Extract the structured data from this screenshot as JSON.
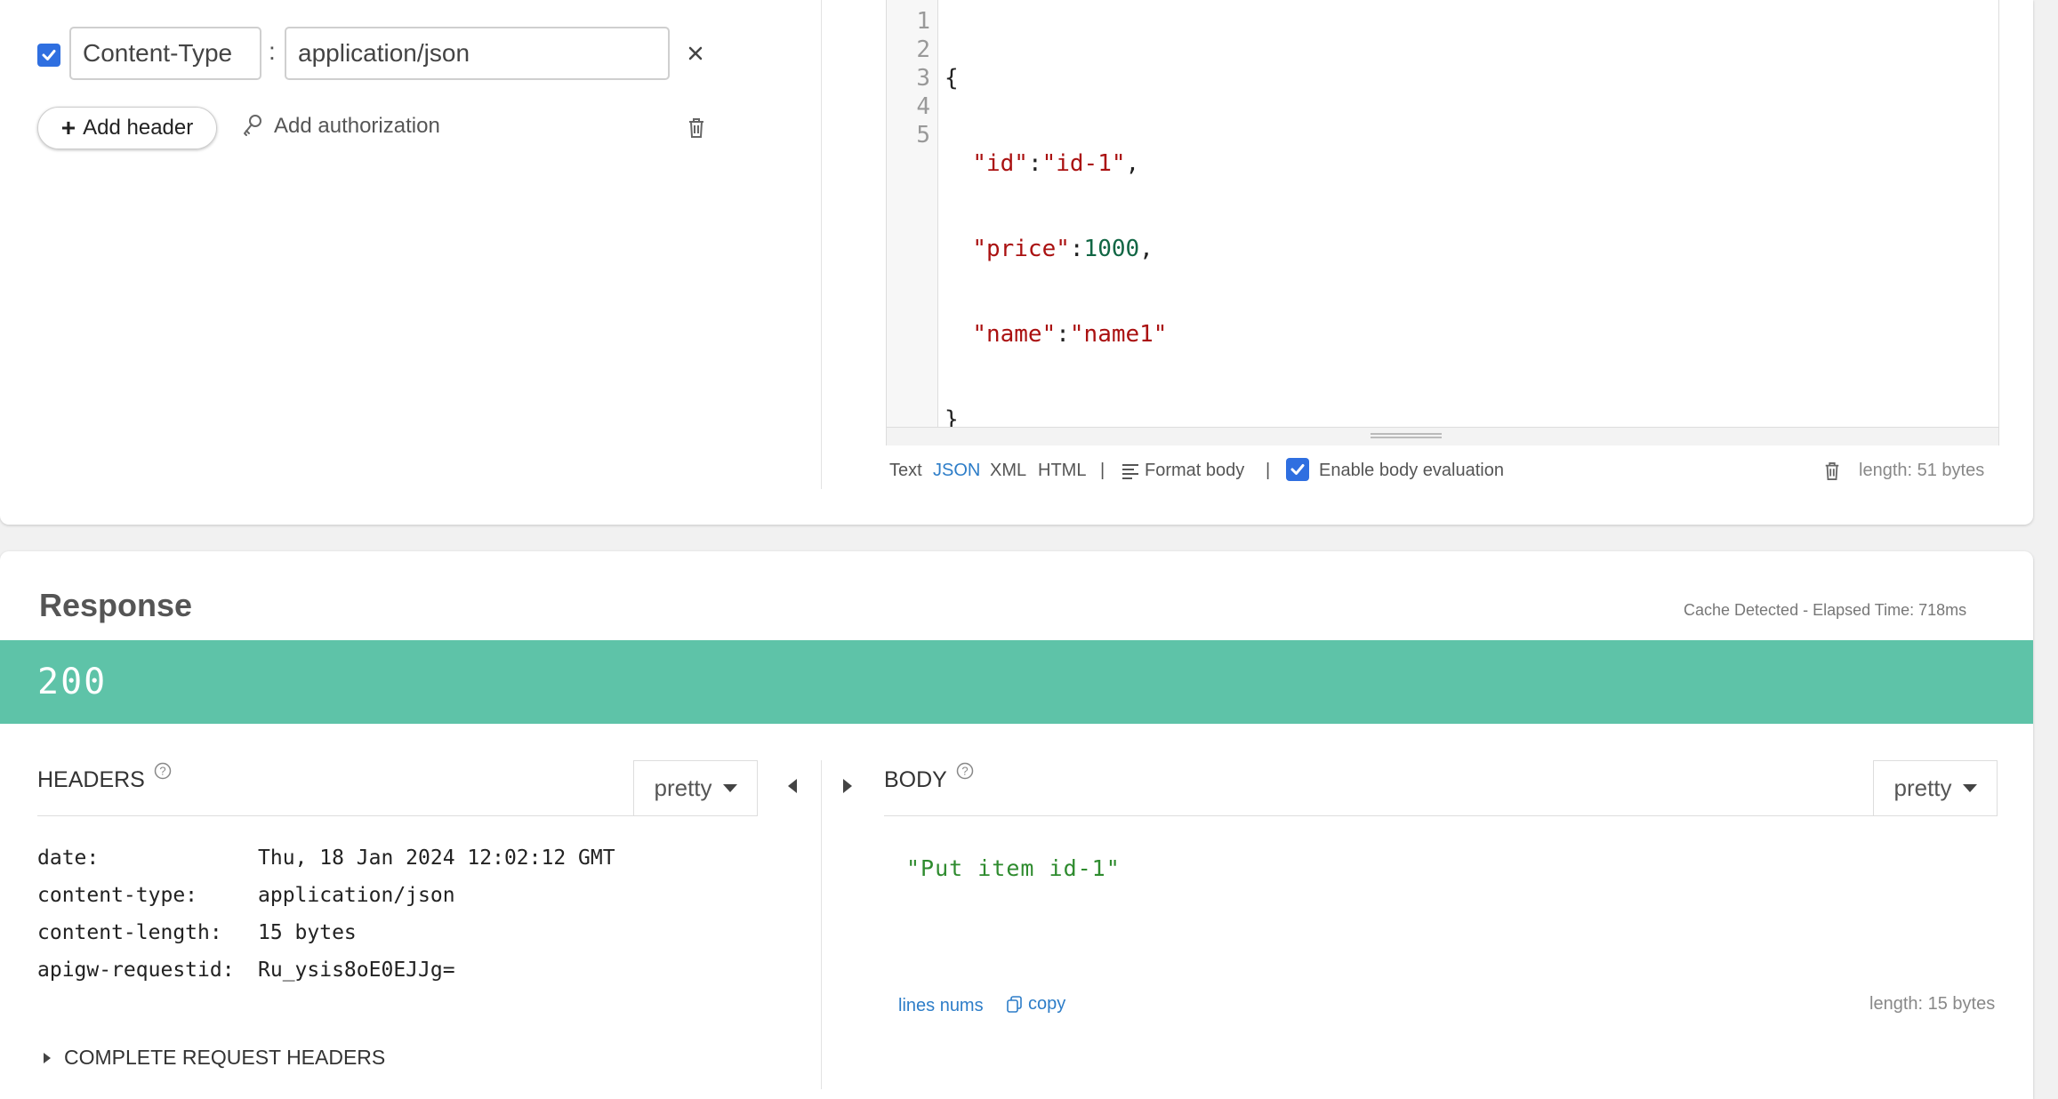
{
  "request": {
    "headers": [
      {
        "enabled": true,
        "name": "Content-Type",
        "separator": ":",
        "value": "application/json"
      }
    ],
    "add_header_label": "Add header",
    "add_auth_label": "Add authorization",
    "body": {
      "line_numbers": [
        "1",
        "2",
        "3",
        "4",
        "5"
      ],
      "line1": "{",
      "line2": {
        "key": "\"id\"",
        "colon": ":",
        "value": "\"id-1\"",
        "comma": ","
      },
      "line3": {
        "key": "\"price\"",
        "colon": ":",
        "value": "1000",
        "comma": ","
      },
      "line4": {
        "key": "\"name\"",
        "colon": ":",
        "value": "\"name1\""
      },
      "line5": "}"
    },
    "body_toolbar": {
      "formats": [
        "Text",
        "JSON",
        "XML",
        "HTML"
      ],
      "active_format": "JSON",
      "sep": "|",
      "format_body": "Format body",
      "enable_eval_label": "Enable body evaluation",
      "enable_eval_checked": true,
      "length": "length: 51 bytes"
    }
  },
  "response": {
    "title": "Response",
    "cache_info": "Cache Detected - Elapsed Time: 718ms",
    "status": "200",
    "status_color": "#5ec3a8",
    "headers_title": "HEADERS",
    "body_title": "BODY",
    "pretty_label": "pretty",
    "headers": [
      {
        "name": "date:",
        "value": "Thu, 18 Jan 2024 12:02:12 GMT"
      },
      {
        "name": "content-type:",
        "value": "application/json"
      },
      {
        "name": "content-length:",
        "value": "15 bytes"
      },
      {
        "name": "apigw-requestid:",
        "value": "Ru_ysis8oE0EJJg="
      }
    ],
    "complete_headers_label": "COMPLETE REQUEST HEADERS",
    "body_value": "\"Put item id-1\"",
    "line_nums_label": "lines nums",
    "copy_label": "copy",
    "body_length": "length: 15 bytes"
  }
}
